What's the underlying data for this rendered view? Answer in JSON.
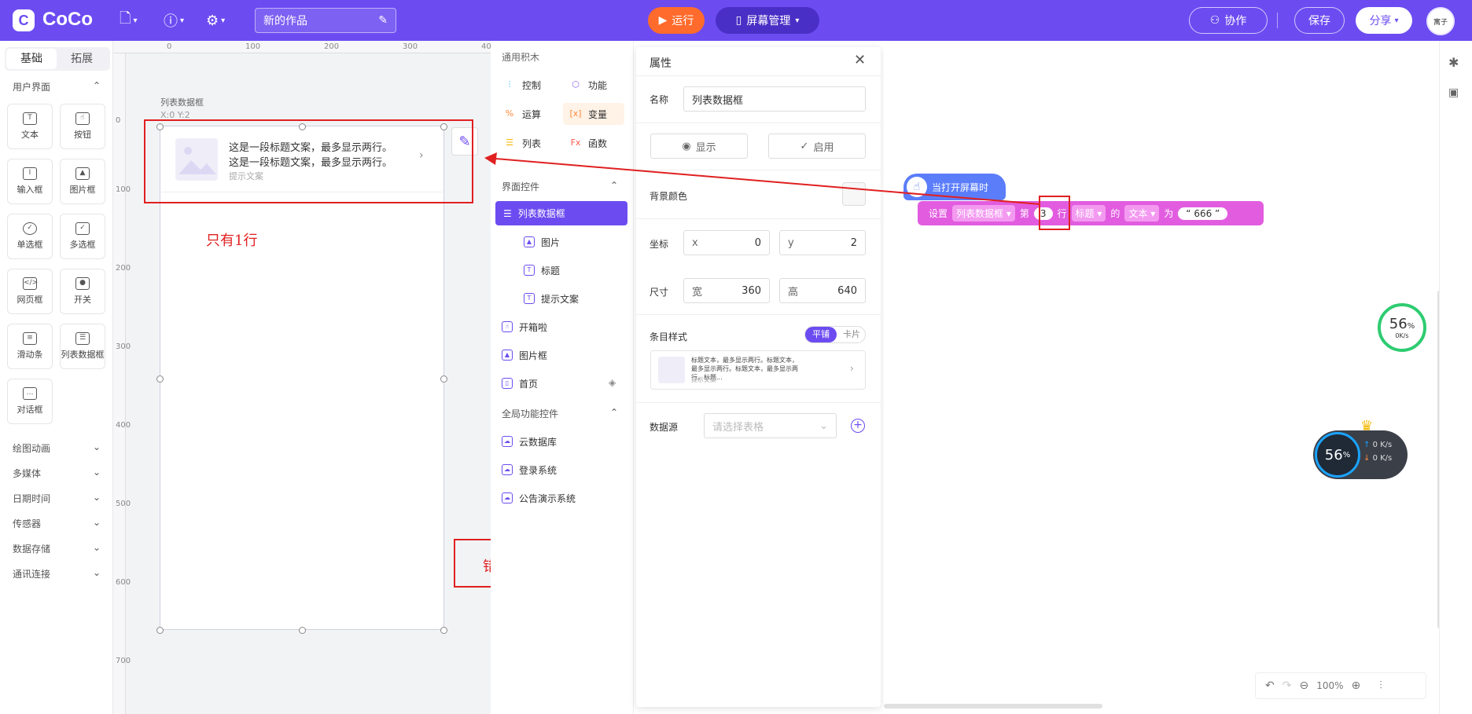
{
  "topbar": {
    "logo": "CoCo",
    "project_title": "新的作品",
    "run_label": "运行",
    "screen_label": "屏幕管理",
    "collab_label": "协作",
    "save_label": "保存",
    "share_label": "分享",
    "avatar_text": "寓子"
  },
  "left_panel": {
    "tabs": [
      "基础",
      "拓展"
    ],
    "ui_section": "用户界面",
    "widgets": [
      "文本",
      "按钮",
      "输入框",
      "图片框",
      "单选框",
      "多选框",
      "网页框",
      "开关",
      "滑动条",
      "列表数据框",
      "对话框"
    ],
    "categories": [
      "绘图动画",
      "多媒体",
      "日期时间",
      "传感器",
      "数据存储",
      "通讯连接"
    ]
  },
  "canvas": {
    "ruler_top": [
      "0",
      "100",
      "200",
      "300",
      "40"
    ],
    "ruler_left": [
      "0",
      "100",
      "200",
      "300",
      "400",
      "500",
      "600",
      "700"
    ],
    "selected_label": "列表数据框",
    "selected_coords": "X:0 Y:2",
    "item_title_line1": "这是一段标题文案，最多显示两行。",
    "item_title_line2": "这是一段标题文案，最多显示两行。",
    "item_hint": "提示文案",
    "note_one_row": "只有1行",
    "note_error": "错误"
  },
  "block_menu": {
    "general_title": "通用积木",
    "general": [
      {
        "label": "控制",
        "color": "#1aa3ff"
      },
      {
        "label": "功能",
        "color": "#8b6cf3"
      },
      {
        "label": "运算",
        "color": "#ff8a3d"
      },
      {
        "label": "变量",
        "color": "#ff8a3d"
      },
      {
        "label": "列表",
        "color": "#f5b700"
      },
      {
        "label": "函数",
        "color": "#ff5a4a"
      }
    ],
    "ui_controls_title": "界面控件",
    "selected_control": "列表数据框",
    "children": [
      "图片",
      "标题",
      "提示文案"
    ],
    "others": [
      "开箱啦",
      "图片框",
      "首页"
    ],
    "global_title": "全局功能控件",
    "global": [
      "云数据库",
      "登录系统",
      "公告演示系统"
    ]
  },
  "properties": {
    "title": "属性",
    "name_label": "名称",
    "name_value": "列表数据框",
    "show_label": "显示",
    "enable_label": "启用",
    "bg_color_label": "背景颜色",
    "coord_label": "坐标",
    "x_label": "x",
    "x_value": "0",
    "y_label": "y",
    "y_value": "2",
    "size_label": "尺寸",
    "w_label": "宽",
    "w_value": "360",
    "h_label": "高",
    "h_value": "640",
    "item_style_label": "条目样式",
    "style_tile": "平铺",
    "style_card": "卡片",
    "preview_text": "标题文本，最多显示两行。标题文本，最多显示两行。标题文本，最多显示两行。标题...",
    "preview_hint": "提示文案",
    "datasource_label": "数据源",
    "datasource_placeholder": "请选择表格"
  },
  "blocks": {
    "event": "当打开屏幕时",
    "set": "设置",
    "target": "列表数据框",
    "nth": "第",
    "row_num": "3",
    "row": "行",
    "field": "标题",
    "of": "的",
    "prop": "文本",
    "to": "为",
    "value": "666"
  },
  "widgets_overlay": {
    "percent": "56",
    "percent_sign": "%",
    "speed": "0K/s",
    "up": "0 K/s",
    "down": "0 K/s"
  },
  "zoom": "100%"
}
